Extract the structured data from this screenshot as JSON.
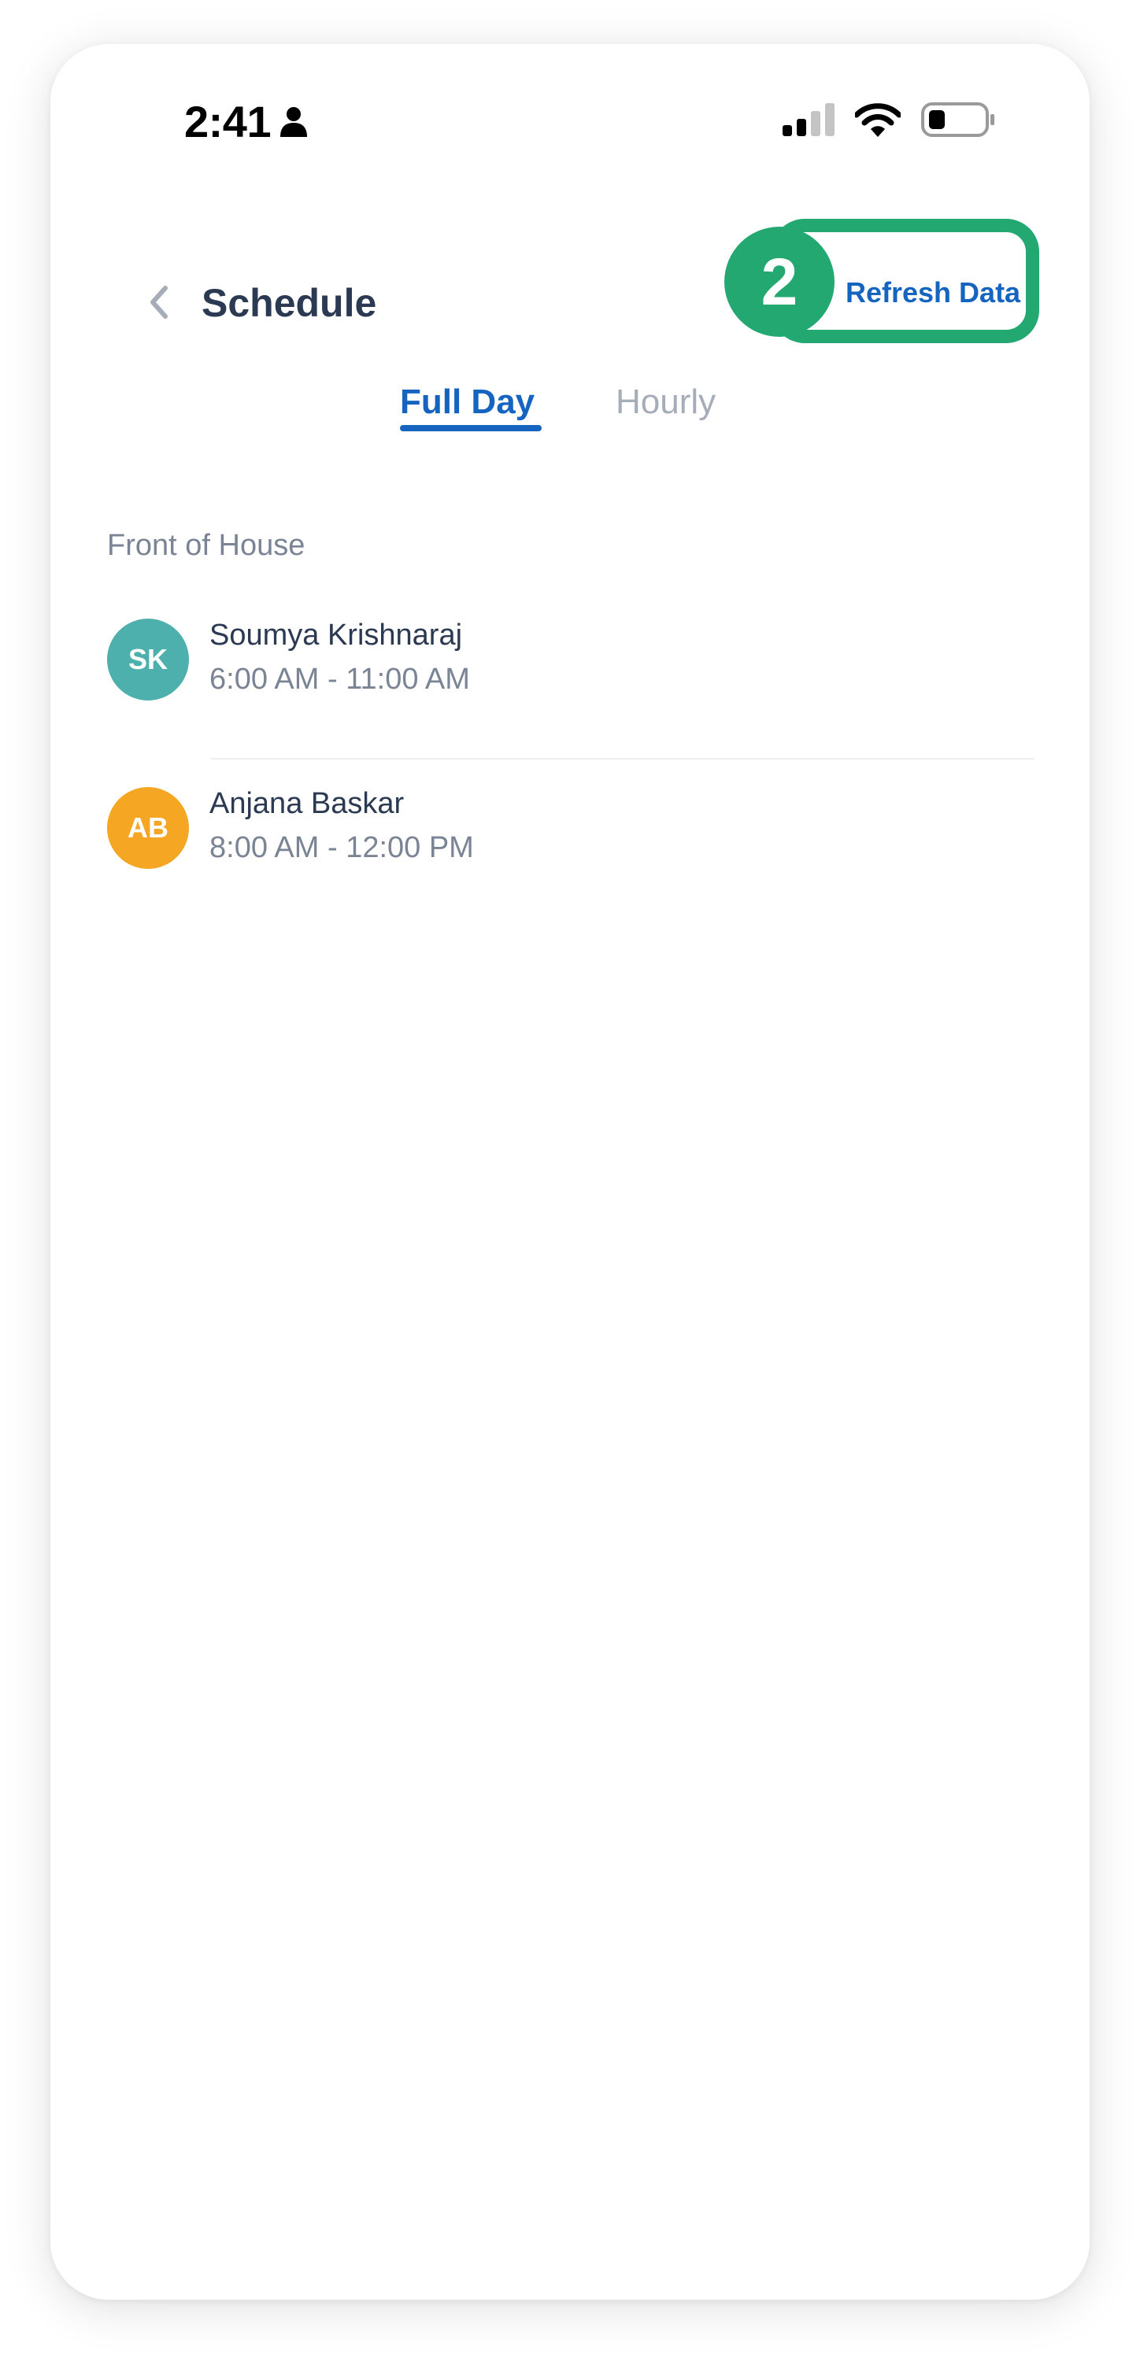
{
  "status_bar": {
    "time": "2:41"
  },
  "header": {
    "title": "Schedule",
    "refresh_label": "Refresh Data",
    "step_number": "2"
  },
  "tabs": [
    {
      "label": "Full Day",
      "active": true
    },
    {
      "label": "Hourly",
      "active": false
    }
  ],
  "section": {
    "heading": "Front of House",
    "items": [
      {
        "initials": "SK",
        "name": "Soumya Krishnaraj",
        "time": "6:00 AM - 11:00 AM",
        "avatar_color": "#4db0ac"
      },
      {
        "initials": "AB",
        "name": "Anjana Baskar",
        "time": "8:00 AM - 12:00 PM",
        "avatar_color": "#f5a623"
      }
    ]
  },
  "colors": {
    "accent": "#1565c0",
    "highlight": "#23a872",
    "title": "#2b3a52",
    "muted": "#7a8494"
  }
}
